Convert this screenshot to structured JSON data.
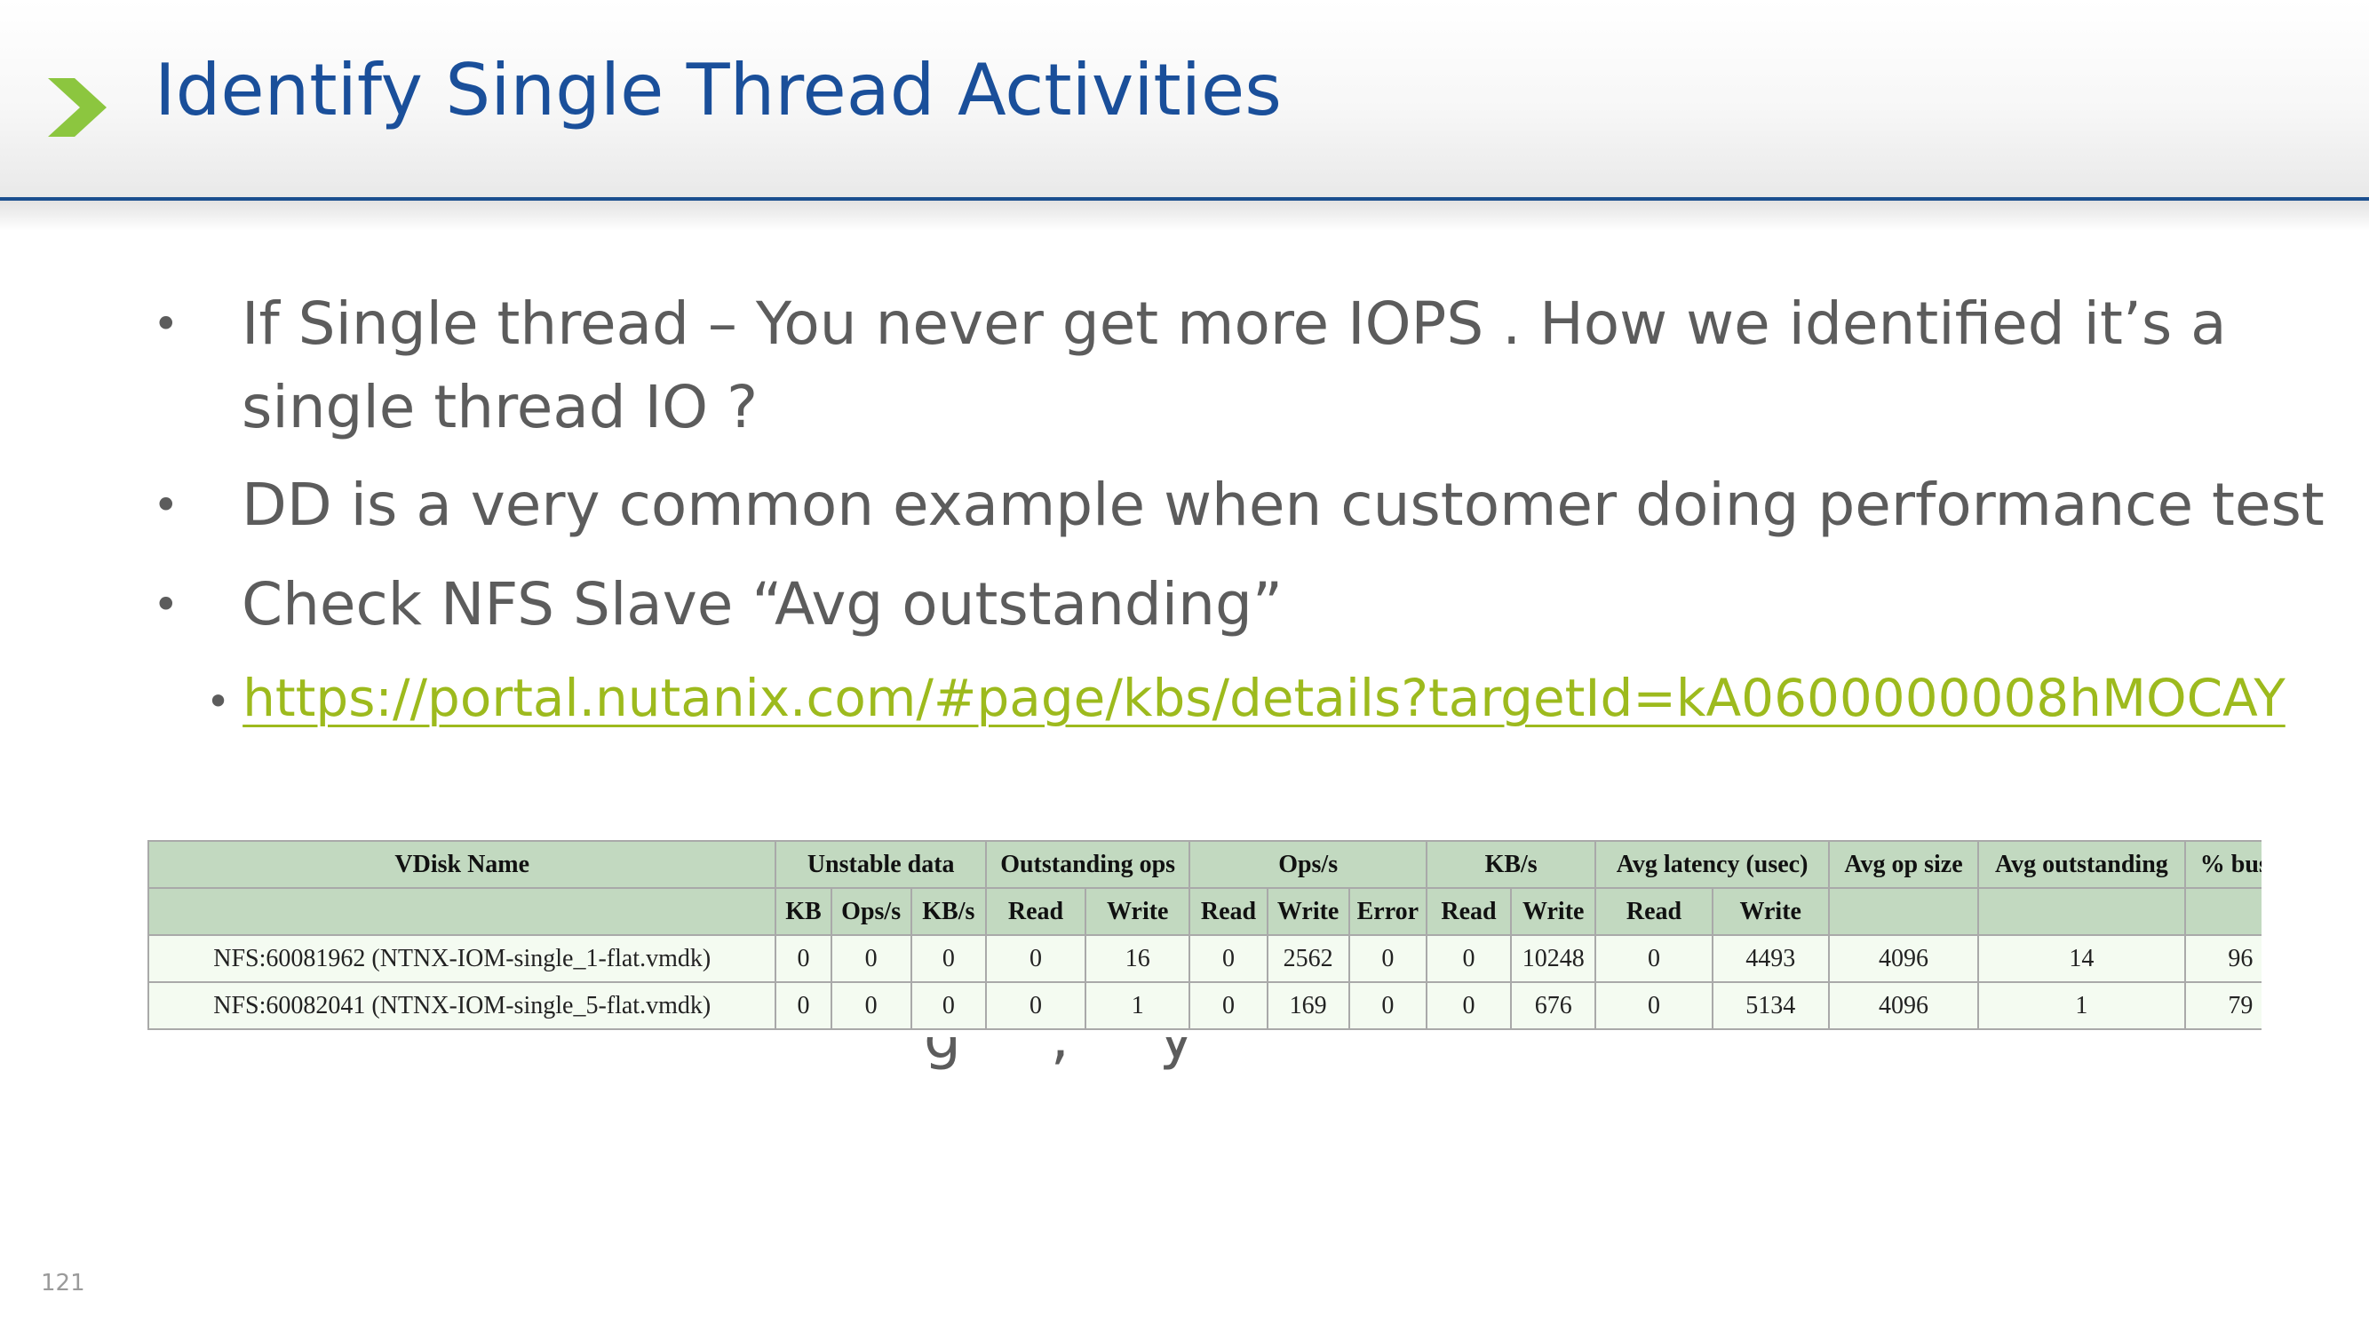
{
  "slide": {
    "title": "Identify Single Thread Activities",
    "page_number": "121",
    "accent_color": "#8cc63f",
    "title_color": "#1a4f9a",
    "link_color": "#9dba1d"
  },
  "bullets": [
    {
      "line1": "If Single thread – You never get more IOPS . How we identified it’s a",
      "line2": "single thread IO ?"
    },
    {
      "line1": "DD is a very common example when customer doing performance test"
    },
    {
      "line1": "Check NFS Slave “Avg outstanding”"
    }
  ],
  "sub_bullet": {
    "link_text": "https://portal.nutanix.com/#page/kbs/details?targetId=kA0600000008hMOCAY"
  },
  "partially_hidden_text": "g , y",
  "table": {
    "group_headers": [
      "VDisk Name",
      "Unstable data",
      "Outstanding ops",
      "Ops/s",
      "KB/s",
      "Avg latency (usec)",
      "Avg op size",
      "Avg outstanding",
      "% busy"
    ],
    "sub_headers": [
      "KB",
      "Ops/s",
      "KB/s",
      "Read",
      "Write",
      "Read",
      "Write",
      "Error",
      "Read",
      "Write",
      "Read",
      "Write"
    ],
    "rows": [
      [
        "NFS:60081962 (NTNX-IOM-single_1-flat.vmdk)",
        "0",
        "0",
        "0",
        "0",
        "16",
        "0",
        "2562",
        "0",
        "0",
        "10248",
        "0",
        "4493",
        "4096",
        "14",
        "96"
      ],
      [
        "NFS:60082041 (NTNX-IOM-single_5-flat.vmdk)",
        "0",
        "0",
        "0",
        "0",
        "1",
        "0",
        "169",
        "0",
        "0",
        "676",
        "0",
        "5134",
        "4096",
        "1",
        "79"
      ]
    ]
  }
}
